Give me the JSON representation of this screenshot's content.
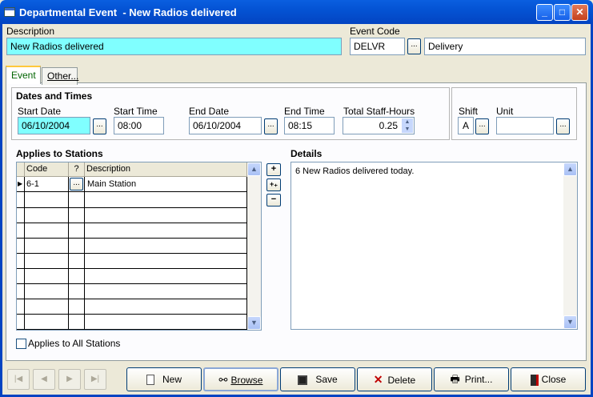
{
  "window": {
    "title": "Departmental Event  - New Radios delivered",
    "controls": [
      "_",
      "□",
      "✕"
    ]
  },
  "description": {
    "label": "Description",
    "value": "New Radios delivered"
  },
  "event_code": {
    "label": "Event Code",
    "code": "DELVR",
    "name": "Delivery",
    "browse": "..."
  },
  "tabs": [
    {
      "label": "Event"
    },
    {
      "label": "Other..."
    }
  ],
  "dates": {
    "heading": "Dates and Times",
    "start_date": {
      "label": "Start Date",
      "value": "06/10/2004"
    },
    "start_time": {
      "label": "Start Time",
      "value": "08:00"
    },
    "end_date": {
      "label": "End Date",
      "value": "06/10/2004"
    },
    "end_time": {
      "label": "End Time",
      "value": "08:15"
    },
    "staff_hours": {
      "label": "Total Staff-Hours",
      "value": "0.25"
    },
    "shift": {
      "label": "Shift",
      "value": "A"
    },
    "unit": {
      "label": "Unit",
      "value": ""
    },
    "ellipsis": "..."
  },
  "stations": {
    "heading": "Applies to Stations",
    "columns": [
      "Code",
      "?",
      "Description"
    ],
    "rows": [
      {
        "code": "6-1",
        "q": "...",
        "description": "Main Station"
      }
    ],
    "buttons": {
      "add": "+",
      "add_multi": "+₊",
      "remove": "−"
    },
    "applies_all": "Applies to All Stations"
  },
  "details": {
    "heading": "Details",
    "text": "6 New Radios delivered today."
  },
  "toolbar": {
    "new": "New",
    "browse": "Browse",
    "save": "Save",
    "delete": "Delete",
    "print": "Print...",
    "close": "Close"
  }
}
